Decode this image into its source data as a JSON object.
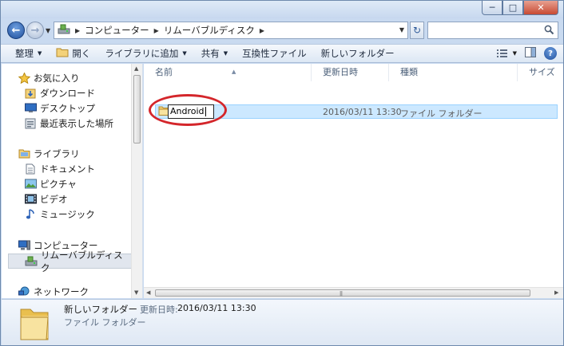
{
  "address_bar": {
    "crumbs": [
      "コンピューター",
      "リムーバブルディスク"
    ]
  },
  "toolbar": {
    "organize": "整理",
    "open": "開く",
    "add_to_library": "ライブラリに追加",
    "share": "共有",
    "compat_files": "互換性ファイル",
    "new_folder": "新しいフォルダー"
  },
  "nav_pane": {
    "favorites": "お気に入り",
    "downloads": "ダウンロード",
    "desktop": "デスクトップ",
    "recent_places": "最近表示した場所",
    "libraries": "ライブラリ",
    "documents": "ドキュメント",
    "pictures": "ピクチャ",
    "videos": "ビデオ",
    "music": "ミュージック",
    "computer": "コンピューター",
    "removable_disk": "リムーバブルディスク",
    "network": "ネットワーク"
  },
  "columns": {
    "name": "名前",
    "date_modified": "更新日時",
    "type": "種類",
    "size": "サイズ"
  },
  "file_row": {
    "rename_value": "Android",
    "date_modified": "2016/03/11 13:30",
    "type": "ファイル フォルダー"
  },
  "details_pane": {
    "name": "新しいフォルダー",
    "modified_label": "更新日時:",
    "modified_value": "2016/03/11 13:30",
    "type": "ファイル フォルダー"
  },
  "colors": {
    "selection_fill": "#cce8ff",
    "annotation_ring": "#d4262b",
    "folder_yellow": "#f3d27a"
  }
}
